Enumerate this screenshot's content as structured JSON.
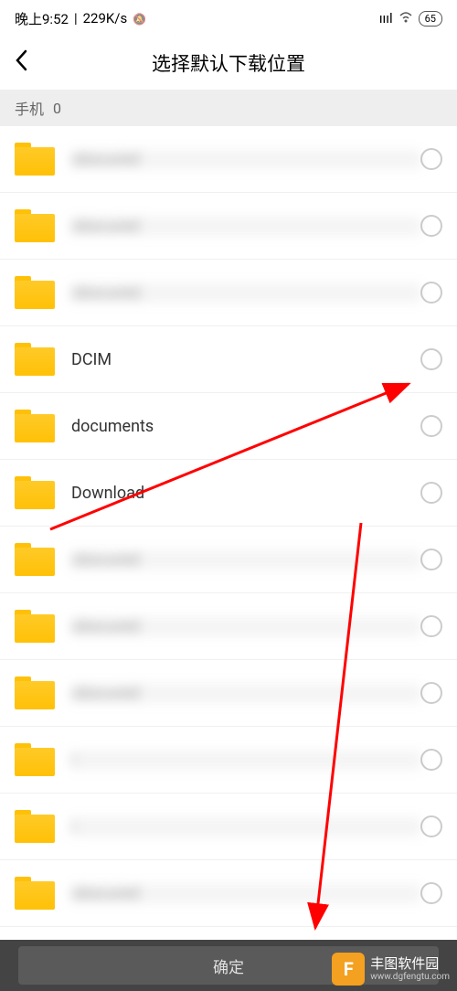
{
  "status": {
    "time": "晚上9:52",
    "speed": "229K/s",
    "battery": "65"
  },
  "header": {
    "title": "选择默认下载位置"
  },
  "breadcrumb": {
    "root": "手机",
    "path": "0"
  },
  "folders": [
    {
      "name": "obscured",
      "blurred": true
    },
    {
      "name": "obscured",
      "blurred": true
    },
    {
      "name": "obscured.",
      "blurred": true
    },
    {
      "name": "DCIM",
      "blurred": false
    },
    {
      "name": "documents",
      "blurred": false
    },
    {
      "name": "Download",
      "blurred": false
    },
    {
      "name": "obscured",
      "blurred": true
    },
    {
      "name": "obscured",
      "blurred": true
    },
    {
      "name": "obscured",
      "blurred": true
    },
    {
      "name": "i",
      "blurred": true
    },
    {
      "name": "i",
      "blurred": true
    },
    {
      "name": "obscured",
      "blurred": true
    }
  ],
  "footer": {
    "confirm": "确定"
  },
  "watermark": {
    "name": "丰图软件园",
    "url": "www.dgfengtu.com",
    "logo": "F"
  }
}
